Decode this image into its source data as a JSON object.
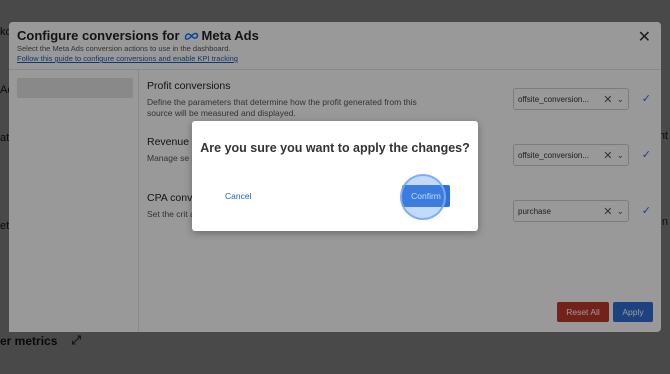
{
  "background": {
    "left_fragments": [
      "ko",
      "Ad",
      "ata",
      "eta"
    ],
    "right_fragments": [
      "nt",
      "n"
    ],
    "metrics_label": "er metrics",
    "expand_icon": "expand-icon"
  },
  "config_modal": {
    "title_prefix": "Configure conversions for",
    "platform": "Meta Ads",
    "subtitle": "Select the Meta Ads conversion actions to use in the dashboard.",
    "guide_link": "Follow this guide to configure conversions and enable KPI tracking",
    "close_label": "✕",
    "sections": [
      {
        "title": "Profit conversions",
        "description": "Define the parameters that determine how the profit generated from this source will be measured and displayed.",
        "selected": "offsite_conversion..."
      },
      {
        "title": "Revenue c",
        "description": "Manage se specific so",
        "selected": "offsite_conversion..."
      },
      {
        "title": "CPA conv",
        "description": "Set the crit action base",
        "selected": "purchase"
      }
    ],
    "reset_label": "Reset All",
    "apply_label": "Apply",
    "colors": {
      "reset": "#c0392b",
      "apply": "#2f6fd6"
    }
  },
  "confirm_dialog": {
    "question": "Are you sure you want to apply the changes?",
    "cancel_label": "Cancel",
    "confirm_label": "Confirm"
  }
}
